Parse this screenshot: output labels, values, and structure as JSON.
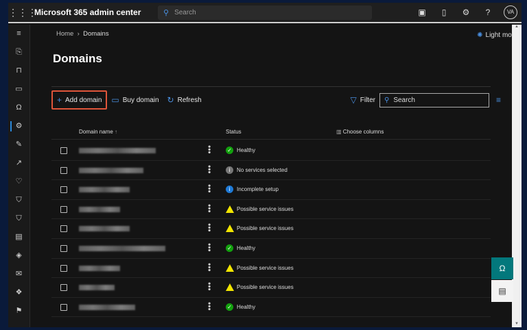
{
  "topbar": {
    "title": "Microsoft 365 admin center",
    "search_placeholder": "Search",
    "avatar": "VA"
  },
  "breadcrumb": {
    "home": "Home",
    "current": "Domains"
  },
  "light_mode": "Light mode",
  "page_title": "Domains",
  "toolbar": {
    "add": "Add domain",
    "buy": "Buy domain",
    "refresh": "Refresh",
    "filter": "Filter",
    "search_placeholder": "Search"
  },
  "table": {
    "col_domain": "Domain name",
    "sort_icon": "↑",
    "col_status": "Status",
    "choose_columns": "Choose columns",
    "rows": [
      {
        "status": "Healthy",
        "kind": "ok"
      },
      {
        "status": "No services selected",
        "kind": "info"
      },
      {
        "status": "Incomplete setup",
        "kind": "inc"
      },
      {
        "status": "Possible service issues",
        "kind": "warn"
      },
      {
        "status": "Possible service issues",
        "kind": "warn"
      },
      {
        "status": "Healthy",
        "kind": "ok"
      },
      {
        "status": "Possible service issues",
        "kind": "warn"
      },
      {
        "status": "Possible service issues",
        "kind": "warn"
      },
      {
        "status": "Healthy",
        "kind": "ok"
      }
    ]
  },
  "colors": {
    "accent": "#4a90e2",
    "highlight": "#e0553a",
    "healthy": "#13a10e",
    "warning": "#f2e600"
  }
}
